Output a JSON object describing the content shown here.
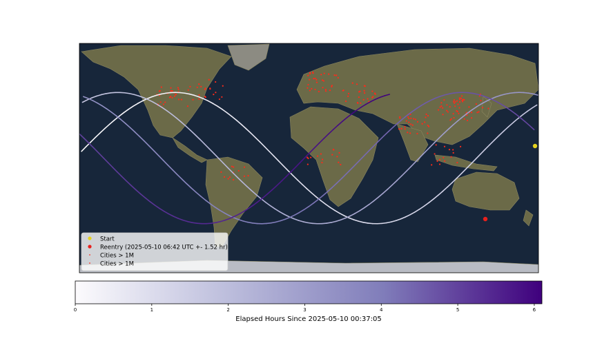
{
  "legend": {
    "start": "Start",
    "reentry": "Reentry (2025-05-10 06:42 UTC +- 1.52 hr)",
    "cities_a": "Cities > 1M",
    "cities_b": "Cities > 1M"
  },
  "colorbar": {
    "label": "Elapsed Hours Since 2025-05-10 00:37:05",
    "ticks": [
      "0",
      "1",
      "2",
      "3",
      "4",
      "5",
      "6"
    ],
    "range": [
      0,
      6.1
    ],
    "colormap_start": "#fcfbfd",
    "colormap_end": "#3f007d"
  },
  "colors": {
    "start_marker": "#e6d21e",
    "reentry_marker": "#e8201c",
    "city_marker": "#ff2a1a",
    "ocean": "#17263a",
    "land": "#6b6a48"
  },
  "chart_data": {
    "type": "map",
    "title": "",
    "ground_track": {
      "units": "elapsed_hours",
      "start_hour": 0,
      "end_hour": 6.1,
      "orbit_period_hours": 1.45
    },
    "markers": [
      {
        "name": "Start",
        "lon": 178,
        "lat": 2
      },
      {
        "name": "Reentry (2025-05-10 06:42 UTC +- 1.52 hr)",
        "lon": 139,
        "lat": -50
      }
    ]
  }
}
